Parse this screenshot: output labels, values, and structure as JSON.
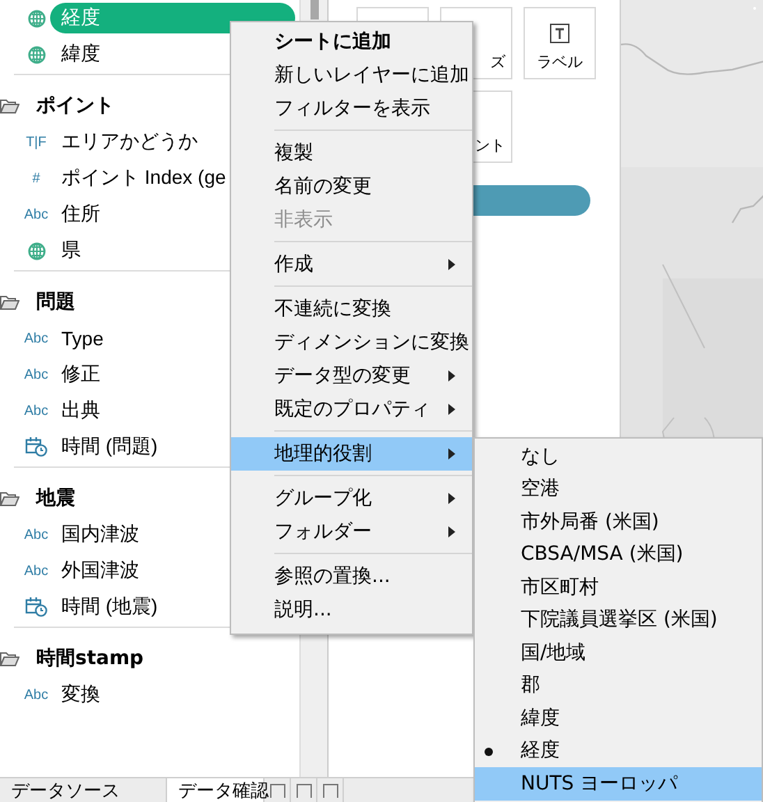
{
  "sidebar": {
    "groups": [
      {
        "fields": [
          {
            "kind": "geo",
            "label": "経度",
            "selected": true
          },
          {
            "kind": "geo",
            "label": "緯度",
            "selected": false
          }
        ]
      },
      {
        "title": "ポイント",
        "fields": [
          {
            "kind": "bool",
            "icon_text": "T|F",
            "label": "エリアかどうか",
            "selected": false
          },
          {
            "kind": "number",
            "icon_text": "#",
            "label": "ポイント Index (ge",
            "selected": false
          },
          {
            "kind": "text",
            "icon_text": "Abc",
            "label": "住所",
            "selected": false
          },
          {
            "kind": "geo",
            "label": "県",
            "selected": false
          }
        ]
      },
      {
        "title": "問題",
        "fields": [
          {
            "kind": "text",
            "icon_text": "Abc",
            "label": "Type",
            "selected": false
          },
          {
            "kind": "text",
            "icon_text": "Abc",
            "label": "修正",
            "selected": false
          },
          {
            "kind": "text",
            "icon_text": "Abc",
            "label": "出典",
            "selected": false
          },
          {
            "kind": "date",
            "label": "時間 (問題)",
            "selected": false
          }
        ]
      },
      {
        "title": "地震",
        "fields": [
          {
            "kind": "text",
            "icon_text": "Abc",
            "label": "国内津波",
            "selected": false
          },
          {
            "kind": "text",
            "icon_text": "Abc",
            "label": "外国津波",
            "selected": false
          },
          {
            "kind": "date",
            "label": "時間 (地震)",
            "selected": false
          }
        ]
      },
      {
        "title": "時間stamp",
        "fields": [
          {
            "kind": "text",
            "icon_text": "Abc",
            "label": "変換",
            "selected": false
          }
        ]
      }
    ]
  },
  "marks_cards": [
    {
      "kind": "blank"
    },
    {
      "kind": "blank",
      "label": "ズ"
    },
    {
      "kind": "text_icon",
      "label": "ラベル"
    },
    {
      "kind": "blank",
      "label": "ント"
    }
  ],
  "bottom_tabs": [
    {
      "label": "データソース",
      "selected": false
    },
    {
      "label": "データ確認",
      "selected": true
    }
  ],
  "context_menu": [
    {
      "kind": "item",
      "label": "シートに追加",
      "bold": true,
      "disabled": false,
      "submenu": false,
      "selected": false
    },
    {
      "kind": "item",
      "label": "新しいレイヤーに追加",
      "bold": false,
      "disabled": false,
      "submenu": false,
      "selected": false
    },
    {
      "kind": "item",
      "label": "フィルターを表示",
      "bold": false,
      "disabled": false,
      "submenu": false,
      "selected": false
    },
    {
      "kind": "separator"
    },
    {
      "kind": "item",
      "label": "複製",
      "bold": false,
      "disabled": false,
      "submenu": false,
      "selected": false
    },
    {
      "kind": "item",
      "label": "名前の変更",
      "bold": false,
      "disabled": false,
      "submenu": false,
      "selected": false
    },
    {
      "kind": "item",
      "label": "非表示",
      "bold": false,
      "disabled": true,
      "submenu": false,
      "selected": false
    },
    {
      "kind": "separator"
    },
    {
      "kind": "item",
      "label": "作成",
      "bold": false,
      "disabled": false,
      "submenu": true,
      "selected": false
    },
    {
      "kind": "separator"
    },
    {
      "kind": "item",
      "label": "不連続に変換",
      "bold": false,
      "disabled": false,
      "submenu": false,
      "selected": false
    },
    {
      "kind": "item",
      "label": "ディメンションに変換",
      "bold": false,
      "disabled": false,
      "submenu": false,
      "selected": false
    },
    {
      "kind": "item",
      "label": "データ型の変更",
      "bold": false,
      "disabled": false,
      "submenu": true,
      "selected": false
    },
    {
      "kind": "item",
      "label": "既定のプロパティ",
      "bold": false,
      "disabled": false,
      "submenu": true,
      "selected": false
    },
    {
      "kind": "separator"
    },
    {
      "kind": "item",
      "label": "地理的役割",
      "bold": false,
      "disabled": false,
      "submenu": true,
      "selected": true
    },
    {
      "kind": "separator"
    },
    {
      "kind": "item",
      "label": "グループ化",
      "bold": false,
      "disabled": false,
      "submenu": true,
      "selected": false
    },
    {
      "kind": "item",
      "label": "フォルダー",
      "bold": false,
      "disabled": false,
      "submenu": true,
      "selected": false
    },
    {
      "kind": "separator"
    },
    {
      "kind": "item",
      "label": "参照の置換...",
      "bold": false,
      "disabled": false,
      "submenu": false,
      "selected": false
    },
    {
      "kind": "item",
      "label": "説明...",
      "bold": false,
      "disabled": false,
      "submenu": false,
      "selected": false
    }
  ],
  "submenu": [
    {
      "label": "なし",
      "checked": false,
      "selected": false
    },
    {
      "label": "空港",
      "checked": false,
      "selected": false
    },
    {
      "label": "市外局番 (米国)",
      "checked": false,
      "selected": false
    },
    {
      "label": "CBSA/MSA (米国)",
      "checked": false,
      "selected": false
    },
    {
      "label": "市区町村",
      "checked": false,
      "selected": false
    },
    {
      "label": "下院議員選挙区 (米国)",
      "checked": false,
      "selected": false
    },
    {
      "label": "国/地域",
      "checked": false,
      "selected": false
    },
    {
      "label": "郡",
      "checked": false,
      "selected": false
    },
    {
      "label": "緯度",
      "checked": false,
      "selected": false
    },
    {
      "label": "経度",
      "checked": true,
      "selected": false
    },
    {
      "label": "NUTS ヨーロッパ",
      "checked": false,
      "selected": true
    }
  ]
}
